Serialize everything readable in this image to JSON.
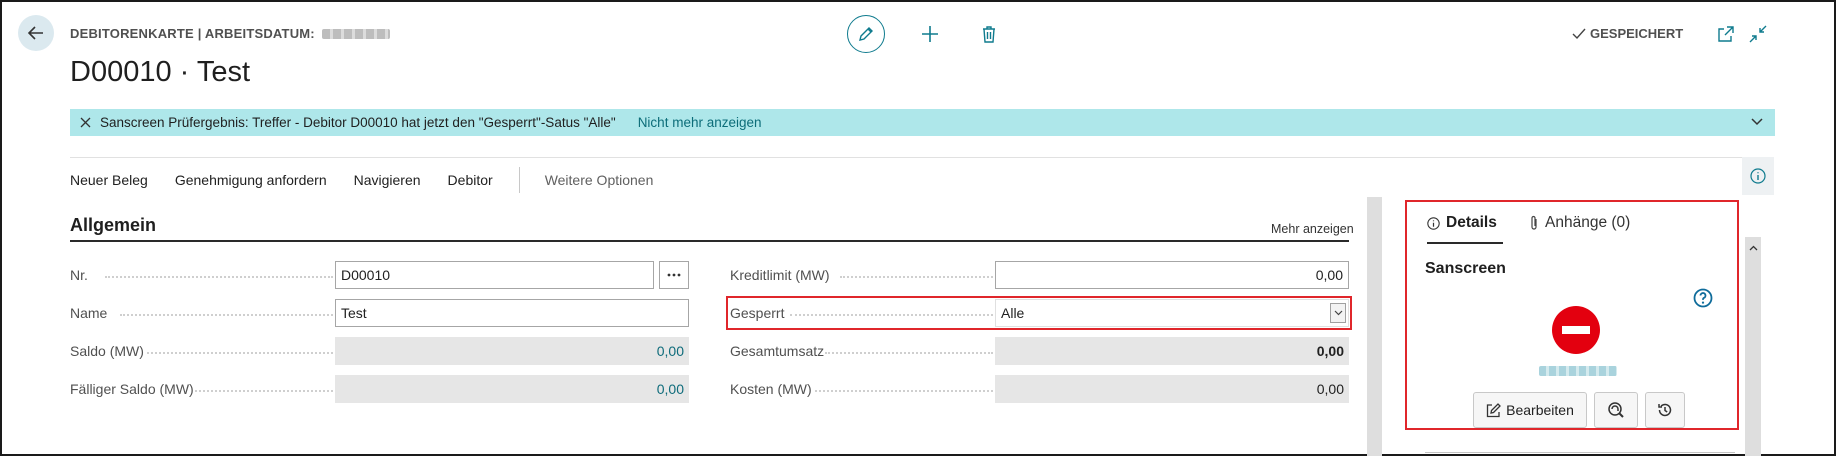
{
  "header": {
    "caption": "DEBITORENKARTE | ARBEITSDATUM:",
    "title": "D00010 · Test",
    "saved_status": "GESPEICHERT",
    "icons": [
      "back-arrow-icon",
      "pencil-icon",
      "plus-icon",
      "trash-icon",
      "checkmark-icon",
      "popout-icon",
      "collapse-icon"
    ]
  },
  "notification": {
    "message": "Sanscreen Prüfergebnis: Treffer - Debitor D00010 hat jetzt den \"Gesperrt\"-Satus \"Alle\"",
    "link": "Nicht mehr anzeigen",
    "background": "#aee7ea"
  },
  "actions": {
    "items": [
      "Neuer Beleg",
      "Genehmigung anfordern",
      "Navigieren",
      "Debitor"
    ],
    "more": "Weitere Optionen"
  },
  "section": {
    "title": "Allgemein",
    "show_more": "Mehr anzeigen"
  },
  "fields_left": [
    {
      "label": "Nr.",
      "value": "D00010"
    },
    {
      "label": "Name",
      "value": "Test"
    },
    {
      "label": "Saldo (MW)",
      "value": "0,00"
    },
    {
      "label": "Fälliger Saldo (MW)",
      "value": "0,00"
    }
  ],
  "fields_right": [
    {
      "label": "Kreditlimit (MW)",
      "value": "0,00"
    },
    {
      "label": "Gesperrt",
      "value": "Alle"
    },
    {
      "label": "Gesamtumsatz",
      "value": "0,00"
    },
    {
      "label": "Kosten (MW)",
      "value": "0,00"
    }
  ],
  "factbox": {
    "tabs": [
      "Details",
      "Anhänge (0)"
    ],
    "title": "Sanscreen",
    "edit_button": "Bearbeiten",
    "accent": "#e0262b",
    "icons": [
      "info-icon",
      "paperclip-icon",
      "help-icon",
      "stop-icon",
      "edit-icon",
      "fingerprint-icon",
      "history-icon"
    ]
  }
}
